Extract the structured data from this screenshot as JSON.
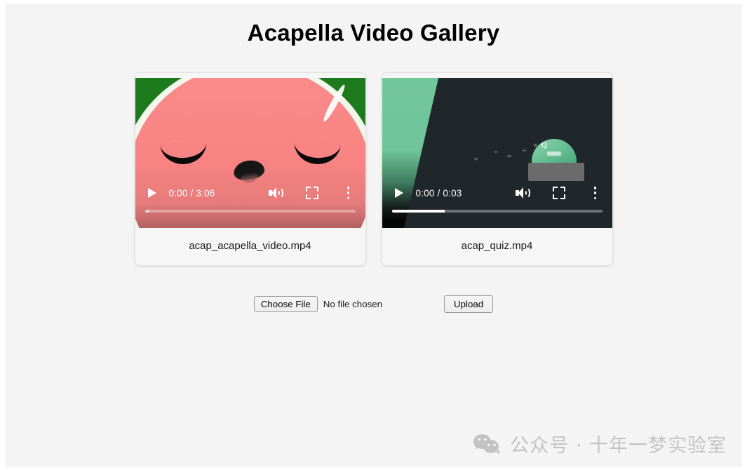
{
  "page": {
    "title": "Acapella Video Gallery",
    "background_color": "#f4f4f4"
  },
  "gallery": {
    "videos": [
      {
        "filename": "acap_acapella_video.mp4",
        "player": {
          "play_label": "play",
          "current_time": "0:00",
          "duration": "3:06",
          "time_display": "0:00 / 3:06",
          "volume_label": "mute",
          "fullscreen_label": "fullscreen",
          "more_label": "more options",
          "progress_percent": 0,
          "buffer_percent": 2
        },
        "thumbnail": {
          "kind": "watermelon-character",
          "rind_color": "#1d7a1d",
          "flesh_color": "#f98383",
          "white_rind_color": "#f1f7ec"
        }
      },
      {
        "filename": "acap_quiz.mp4",
        "player": {
          "play_label": "play",
          "current_time": "0:00",
          "duration": "0:03",
          "time_display": "0:00 / 0:03",
          "volume_label": "mute",
          "fullscreen_label": "fullscreen",
          "more_label": "more options",
          "progress_percent": 0,
          "buffer_percent": 25
        },
        "thumbnail": {
          "kind": "quiz-dome-character",
          "background_color": "#20272a",
          "accent_color": "#6fc599",
          "dome_letter": "Q",
          "base_color": "#6b6b6b"
        }
      }
    ]
  },
  "upload": {
    "choose_file_label": "Choose File",
    "no_file_text": "No file chosen",
    "upload_label": "Upload"
  },
  "watermark": {
    "icon": "wechat-icon",
    "text": "公众号 · 十年一梦实验室",
    "color": "#c3c3c3"
  }
}
